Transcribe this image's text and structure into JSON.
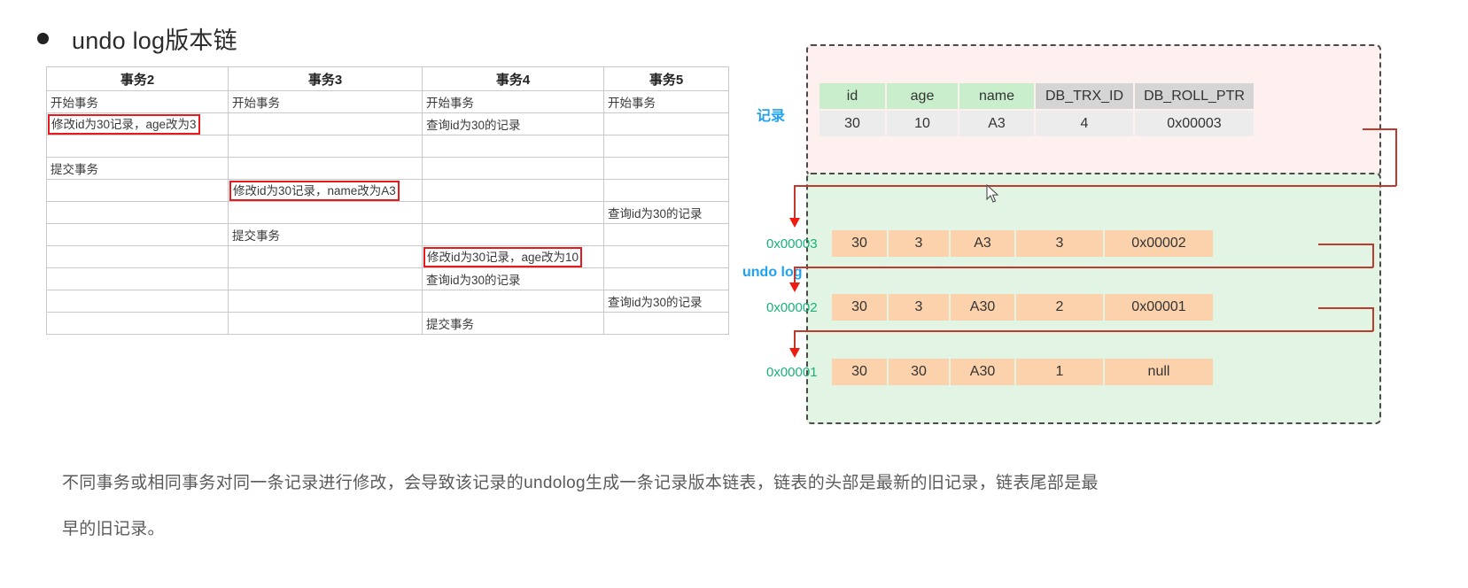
{
  "heading": {
    "bullet_icon": "bullet-dot-icon",
    "text": "undo log版本链"
  },
  "sheet": {
    "headers": [
      "事务2",
      "事务3",
      "事务4",
      "事务5"
    ],
    "rows": [
      [
        {
          "t": "开始事务",
          "boxed": false
        },
        {
          "t": "开始事务",
          "boxed": false
        },
        {
          "t": "开始事务",
          "boxed": false
        },
        {
          "t": "开始事务",
          "boxed": false
        }
      ],
      [
        {
          "t": "修改id为30记录，age改为3",
          "boxed": true
        },
        {
          "t": "",
          "boxed": false
        },
        {
          "t": "查询id为30的记录",
          "boxed": false
        },
        {
          "t": "",
          "boxed": false
        }
      ],
      [
        {
          "t": "",
          "boxed": false
        },
        {
          "t": "",
          "boxed": false
        },
        {
          "t": "",
          "boxed": false
        },
        {
          "t": "",
          "boxed": false
        }
      ],
      [
        {
          "t": "提交事务",
          "boxed": false
        },
        {
          "t": "",
          "boxed": false
        },
        {
          "t": "",
          "boxed": false
        },
        {
          "t": "",
          "boxed": false
        }
      ],
      [
        {
          "t": "",
          "boxed": false
        },
        {
          "t": "修改id为30记录，name改为A3",
          "boxed": true
        },
        {
          "t": "",
          "boxed": false
        },
        {
          "t": "",
          "boxed": false
        }
      ],
      [
        {
          "t": "",
          "boxed": false
        },
        {
          "t": "",
          "boxed": false
        },
        {
          "t": "",
          "boxed": false
        },
        {
          "t": "查询id为30的记录",
          "boxed": false
        }
      ],
      [
        {
          "t": "",
          "boxed": false
        },
        {
          "t": "提交事务",
          "boxed": false
        },
        {
          "t": "",
          "boxed": false
        },
        {
          "t": "",
          "boxed": false
        }
      ],
      [
        {
          "t": "",
          "boxed": false
        },
        {
          "t": "",
          "boxed": false
        },
        {
          "t": "修改id为30记录，age改为10",
          "boxed": true
        },
        {
          "t": "",
          "boxed": false
        }
      ],
      [
        {
          "t": "",
          "boxed": false
        },
        {
          "t": "",
          "boxed": false
        },
        {
          "t": "查询id为30的记录",
          "boxed": false
        },
        {
          "t": "",
          "boxed": false
        }
      ],
      [
        {
          "t": "",
          "boxed": false
        },
        {
          "t": "",
          "boxed": false
        },
        {
          "t": "",
          "boxed": false
        },
        {
          "t": "查询id为30的记录",
          "boxed": false
        }
      ],
      [
        {
          "t": "",
          "boxed": false
        },
        {
          "t": "",
          "boxed": false
        },
        {
          "t": "提交事务",
          "boxed": false
        },
        {
          "t": "",
          "boxed": false
        }
      ]
    ]
  },
  "diagram": {
    "labels": {
      "record": "记录",
      "undo_log": "undo log"
    },
    "record_table": {
      "headers": [
        "id",
        "age",
        "name",
        "DB_TRX_ID",
        "DB_ROLL_PTR"
      ],
      "row": [
        "30",
        "10",
        "A3",
        "4",
        "0x00003"
      ]
    },
    "undo_rows": [
      {
        "addr": "0x00003",
        "values": [
          "30",
          "3",
          "A3",
          "3",
          "0x00002"
        ]
      },
      {
        "addr": "0x00002",
        "values": [
          "30",
          "3",
          "A30",
          "2",
          "0x00001"
        ]
      },
      {
        "addr": "0x00001",
        "values": [
          "30",
          "30",
          "A30",
          "1",
          "null"
        ]
      }
    ],
    "colors": {
      "record_panel_bg": "#fdf0ef",
      "undo_panel_bg": "#e2f5e4",
      "header_green": "#c9eecb",
      "header_gray": "#d5d5d5",
      "undo_cell": "#fbd2ac",
      "label_blue": "#1fa2f0",
      "addr_green": "#18b27a",
      "connector_red": "#c0392b"
    }
  },
  "paragraph": {
    "line1": "不同事务或相同事务对同一条记录进行修改，会导致该记录的undolog生成一条记录版本链表，链表的头部是最新的旧记录，链表尾部是最",
    "line2": "早的旧记录。"
  }
}
